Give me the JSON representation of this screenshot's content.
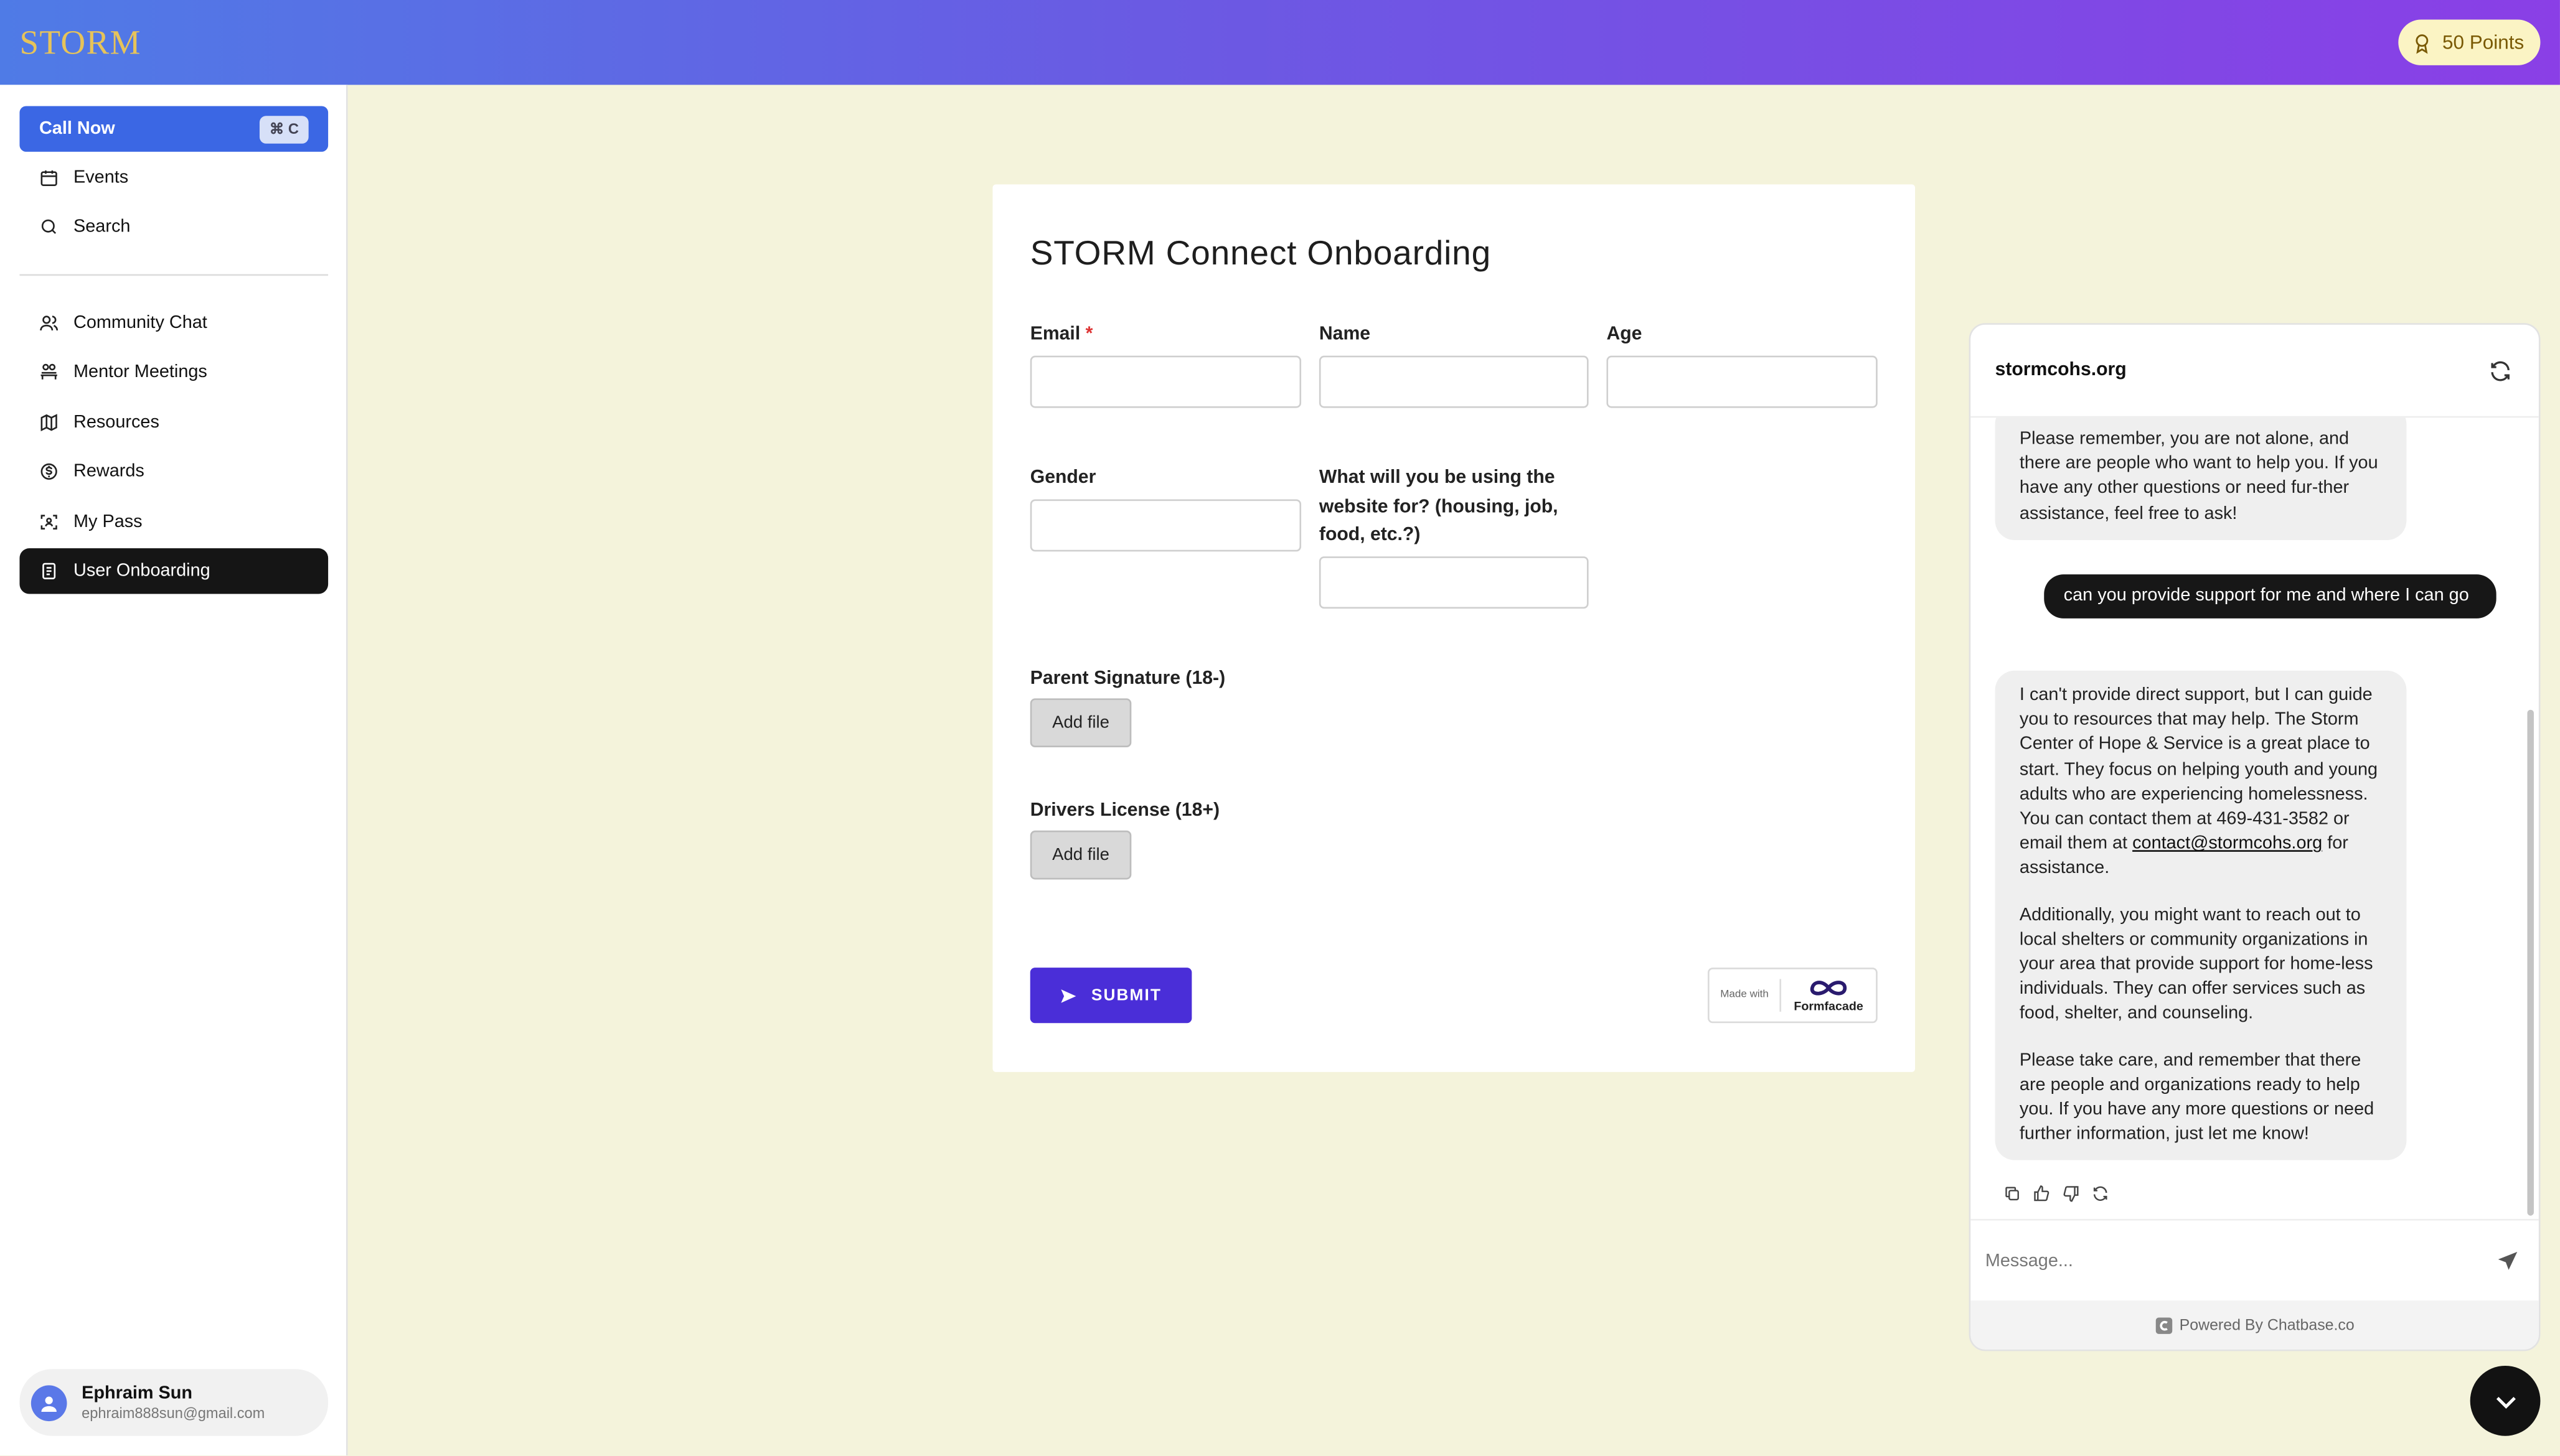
{
  "header": {
    "logo_text": "STORM",
    "points_label": "50 Points"
  },
  "sidebar": {
    "call_now": {
      "label": "Call Now",
      "shortcut": "⌘ C"
    },
    "top_items": [
      {
        "label": "Events",
        "icon": "calendar-icon"
      },
      {
        "label": "Search",
        "icon": "search-icon"
      }
    ],
    "items": [
      {
        "label": "Community Chat",
        "icon": "users-icon"
      },
      {
        "label": "Mentor Meetings",
        "icon": "meeting-icon"
      },
      {
        "label": "Resources",
        "icon": "map-icon"
      },
      {
        "label": "Rewards",
        "icon": "dollar-circle-icon"
      },
      {
        "label": "My Pass",
        "icon": "scan-icon"
      },
      {
        "label": "User Onboarding",
        "icon": "document-icon",
        "active": true
      }
    ],
    "user": {
      "name": "Ephraim Sun",
      "email": "ephraim888sun@gmail.com"
    }
  },
  "form": {
    "title": "STORM Connect Onboarding",
    "email_label": "Email",
    "required_mark": "*",
    "name_label": "Name",
    "age_label": "Age",
    "gender_label": "Gender",
    "purpose_label": "What will you be using the website for? (housing, job, food, etc.?)",
    "parent_signature_label": "Parent Signature (18-)",
    "drivers_license_label": "Drivers License (18+)",
    "add_file_label": "Add file",
    "submit_label": "SUBMIT",
    "badge_made_with": "Made with",
    "badge_brand": "Formfacade",
    "values": {
      "email": "",
      "name": "",
      "age": "",
      "gender": "",
      "purpose": ""
    }
  },
  "chat": {
    "title": "stormcohs.org",
    "messages": {
      "bot_1": "Please remember, you are not alone, and there are people who want to help you. If you have any other questions or need fur-ther assistance, feel free to ask!",
      "user_1": "can you provide support for me and where I can go",
      "bot_2_p1_a": "I can't provide direct support, but I can guide you to resources that may help. The Storm Center of Hope & Service is a great place to start. They focus on helping youth and young adults who are experiencing homelessness. You can contact them at 469-431-3582 or email them at",
      "bot_2_link": "contact@stormcohs.org",
      "bot_2_p1_b": "for assistance.",
      "bot_2_p2": "Additionally, you might want to reach out to local shelters or community organizations in your area that provide support for home-less individuals. They can offer services such as food, shelter, and counseling.",
      "bot_2_p3": "Please take care, and remember that there are people and organizations ready to help you. If you have any more questions or need further information, just let me know!"
    },
    "input_placeholder": "Message...",
    "input_value": "",
    "footer": "Powered By Chatbase.co"
  },
  "colors": {
    "header_gradient_start": "#4f7be6",
    "header_gradient_end": "#8a3fe6",
    "page_background": "#f4f3db",
    "call_now": "#3b67e4",
    "submit": "#4a2ed8",
    "active_nav": "#151515"
  }
}
